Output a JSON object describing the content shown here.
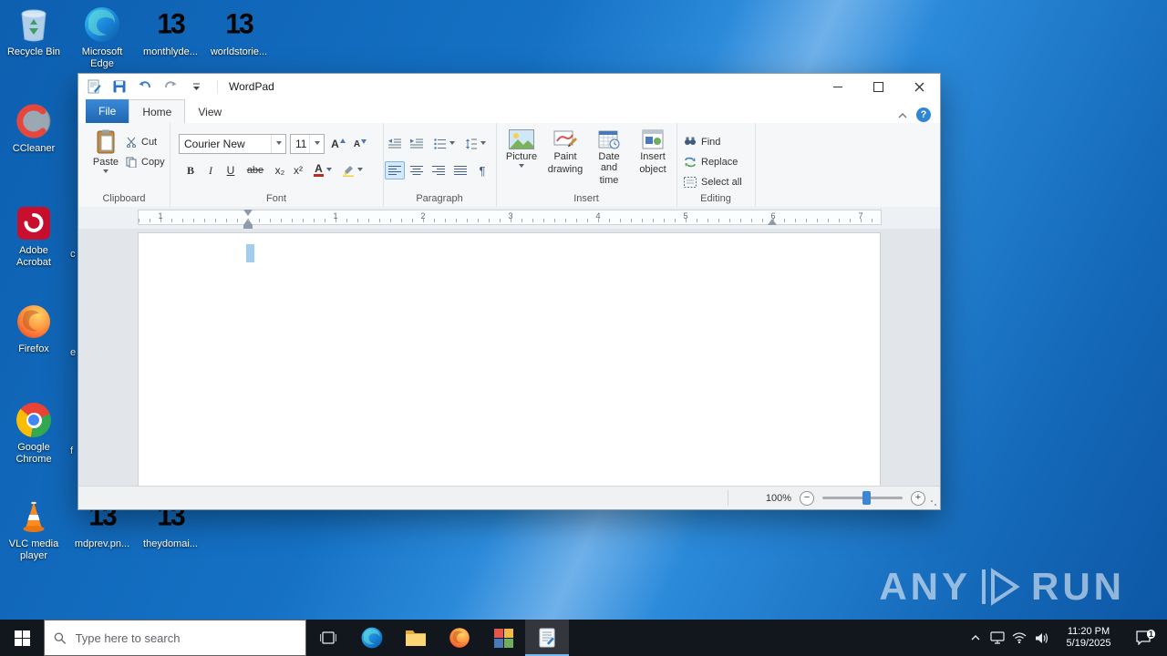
{
  "desktop": {
    "icons": [
      {
        "label_lines": [
          "Recycle Bin"
        ]
      },
      {
        "label_lines": [
          "Microsoft",
          "Edge"
        ]
      },
      {
        "label_lines": [
          "monthlyde..."
        ]
      },
      {
        "label_lines": [
          "worldstorie..."
        ]
      },
      {
        "label_lines": [
          "CCleaner"
        ]
      },
      {
        "label_lines": [
          "Adobe",
          "Acrobat"
        ]
      },
      {
        "label_lines": [
          "Firefox"
        ]
      },
      {
        "label_lines": [
          "Google",
          "Chrome"
        ]
      },
      {
        "label_lines": [
          "VLC media",
          "player"
        ]
      },
      {
        "label_lines": [
          "mdprev.pn..."
        ]
      },
      {
        "label_lines": [
          "theydomai..."
        ]
      }
    ],
    "fragments": [
      "c",
      "e",
      "f"
    ],
    "watermark": {
      "left": "ANY",
      "right": "RUN"
    }
  },
  "window": {
    "title": "WordPad",
    "tabs": {
      "file": "File",
      "home": "Home",
      "view": "View"
    },
    "ribbon": {
      "clipboard": {
        "group": "Clipboard",
        "paste": "Paste",
        "cut": "Cut",
        "copy": "Copy"
      },
      "font": {
        "group": "Font",
        "family": "Courier New",
        "size": "11",
        "bold": "B",
        "italic": "I",
        "underline": "U",
        "strike": "abe",
        "subscript": "x₂",
        "superscript": "x²",
        "color_letter": "A"
      },
      "paragraph": {
        "group": "Paragraph"
      },
      "insert": {
        "group": "Insert",
        "picture": "Picture",
        "paint_line1": "Paint",
        "paint_line2": "drawing",
        "date_line1": "Date and",
        "date_line2": "time",
        "object_line1": "Insert",
        "object_line2": "object"
      },
      "editing": {
        "group": "Editing",
        "find": "Find",
        "replace": "Replace",
        "select_all": "Select all"
      }
    },
    "ruler_numbers": [
      "1",
      "1",
      "2",
      "3",
      "4",
      "5",
      "6",
      "7"
    ],
    "status": {
      "zoom": "100%",
      "zoom_out": "−",
      "zoom_in": "+"
    }
  },
  "taskbar": {
    "search_placeholder": "Type here to search",
    "clock": {
      "time": "11:20 PM",
      "date": "5/19/2025"
    },
    "action_badge": "1"
  }
}
